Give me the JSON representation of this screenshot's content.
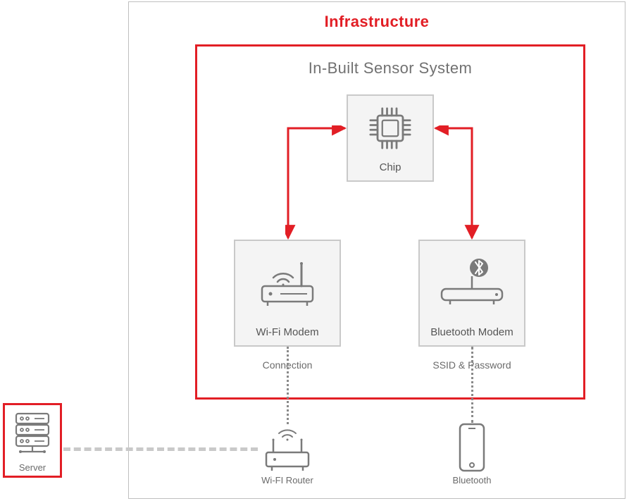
{
  "title": "Infrastructure",
  "sensorTitle": "In-Built Sensor System",
  "nodes": {
    "chip": {
      "label": "Chip"
    },
    "wifi": {
      "label": "Wi-Fi Modem",
      "sub": "Connection"
    },
    "bt": {
      "label": "Bluetooth Modem",
      "sub": "SSID & Password"
    }
  },
  "externals": {
    "router": {
      "label": "Wi-FI Router"
    },
    "phone": {
      "label": "Bluetooth"
    },
    "server": {
      "label": "Server"
    }
  }
}
